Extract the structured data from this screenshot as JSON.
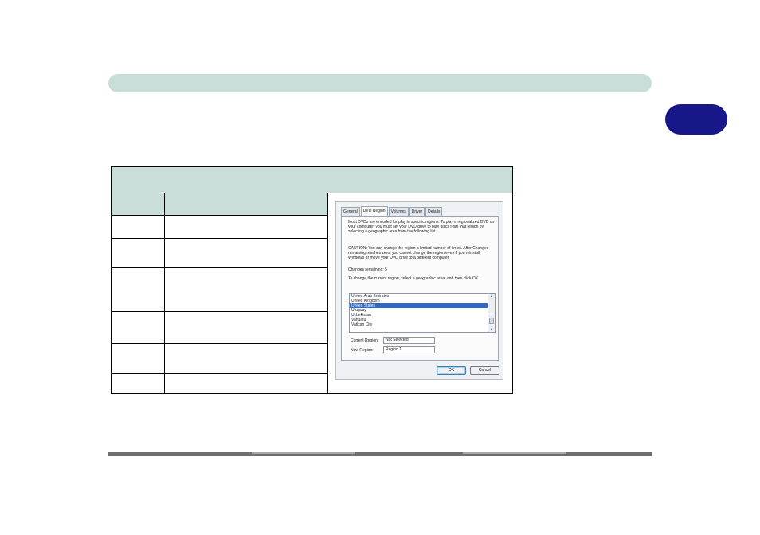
{
  "page": {
    "header_bar_color": "#c9ddd9",
    "chapter_tab_color": "#17178a",
    "table_header_color": "#c9ddd9"
  },
  "dialog": {
    "tabs": [
      "General",
      "DVD Region",
      "Volumes",
      "Driver",
      "Details"
    ],
    "active_tab": "DVD Region",
    "intro_text": "Most DVDs are encoded for play in specific regions. To play a regionalized DVD on your computer, you must set your DVD drive to play discs from that region by selecting a geographic area from the following list.",
    "caution_text": "CAUTION: You can change the region a limited number of times. After Changes remaining reaches zero, you cannot change the region even if you reinstall Windows or move your DVD drive to a different computer.",
    "changes_remaining": "Changes remaining: 5",
    "instruction_text": "To change the current region, select a geographic area, and then click OK.",
    "regions": [
      "United Arab Emirates",
      "United Kingdom",
      "United States",
      "Uruguay",
      "Uzbekistan",
      "Vanuatu",
      "Vatican City"
    ],
    "selected_region": "United States",
    "current_region_label": "Current Region:",
    "current_region_value": "Not Selected",
    "new_region_label": "New Region:",
    "new_region_value": "Region 1",
    "ok_label": "OK",
    "cancel_label": "Cancel"
  }
}
